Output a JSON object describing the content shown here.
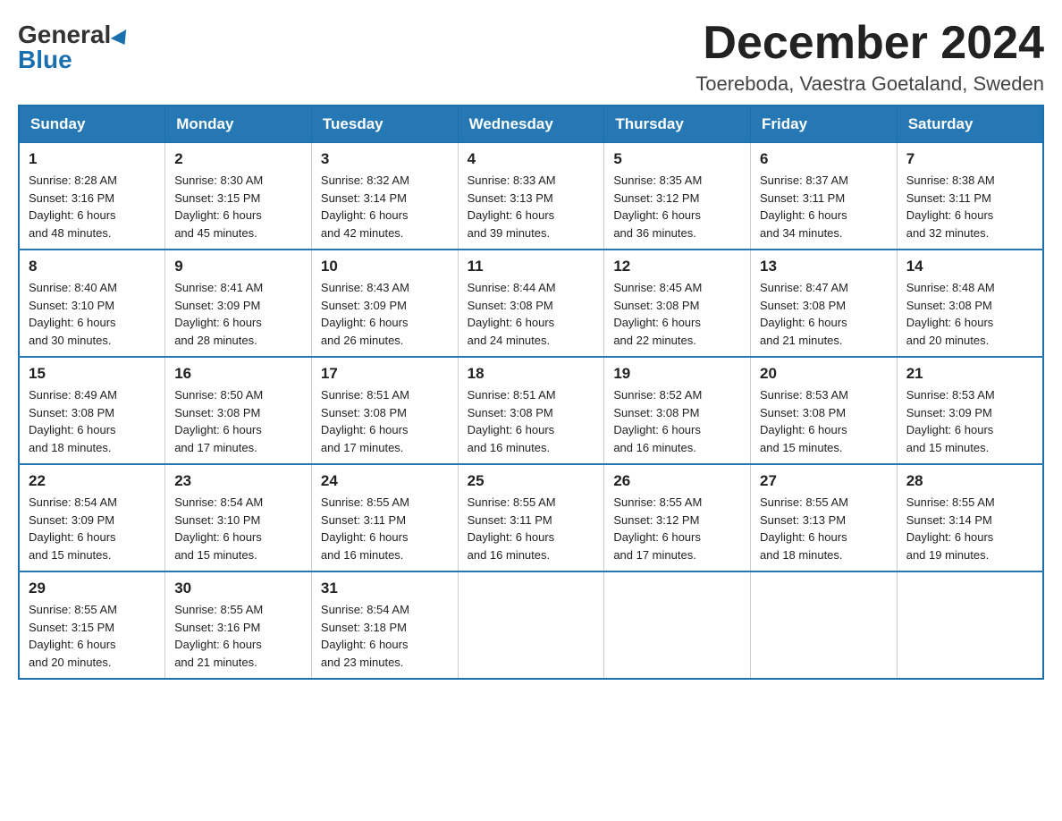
{
  "header": {
    "logo_general": "General",
    "logo_blue": "Blue",
    "month_title": "December 2024",
    "location": "Toereboda, Vaestra Goetaland, Sweden"
  },
  "weekdays": [
    "Sunday",
    "Monday",
    "Tuesday",
    "Wednesday",
    "Thursday",
    "Friday",
    "Saturday"
  ],
  "weeks": [
    [
      {
        "day": "1",
        "sunrise": "8:28 AM",
        "sunset": "3:16 PM",
        "daylight": "6 hours and 48 minutes."
      },
      {
        "day": "2",
        "sunrise": "8:30 AM",
        "sunset": "3:15 PM",
        "daylight": "6 hours and 45 minutes."
      },
      {
        "day": "3",
        "sunrise": "8:32 AM",
        "sunset": "3:14 PM",
        "daylight": "6 hours and 42 minutes."
      },
      {
        "day": "4",
        "sunrise": "8:33 AM",
        "sunset": "3:13 PM",
        "daylight": "6 hours and 39 minutes."
      },
      {
        "day": "5",
        "sunrise": "8:35 AM",
        "sunset": "3:12 PM",
        "daylight": "6 hours and 36 minutes."
      },
      {
        "day": "6",
        "sunrise": "8:37 AM",
        "sunset": "3:11 PM",
        "daylight": "6 hours and 34 minutes."
      },
      {
        "day": "7",
        "sunrise": "8:38 AM",
        "sunset": "3:11 PM",
        "daylight": "6 hours and 32 minutes."
      }
    ],
    [
      {
        "day": "8",
        "sunrise": "8:40 AM",
        "sunset": "3:10 PM",
        "daylight": "6 hours and 30 minutes."
      },
      {
        "day": "9",
        "sunrise": "8:41 AM",
        "sunset": "3:09 PM",
        "daylight": "6 hours and 28 minutes."
      },
      {
        "day": "10",
        "sunrise": "8:43 AM",
        "sunset": "3:09 PM",
        "daylight": "6 hours and 26 minutes."
      },
      {
        "day": "11",
        "sunrise": "8:44 AM",
        "sunset": "3:08 PM",
        "daylight": "6 hours and 24 minutes."
      },
      {
        "day": "12",
        "sunrise": "8:45 AM",
        "sunset": "3:08 PM",
        "daylight": "6 hours and 22 minutes."
      },
      {
        "day": "13",
        "sunrise": "8:47 AM",
        "sunset": "3:08 PM",
        "daylight": "6 hours and 21 minutes."
      },
      {
        "day": "14",
        "sunrise": "8:48 AM",
        "sunset": "3:08 PM",
        "daylight": "6 hours and 20 minutes."
      }
    ],
    [
      {
        "day": "15",
        "sunrise": "8:49 AM",
        "sunset": "3:08 PM",
        "daylight": "6 hours and 18 minutes."
      },
      {
        "day": "16",
        "sunrise": "8:50 AM",
        "sunset": "3:08 PM",
        "daylight": "6 hours and 17 minutes."
      },
      {
        "day": "17",
        "sunrise": "8:51 AM",
        "sunset": "3:08 PM",
        "daylight": "6 hours and 17 minutes."
      },
      {
        "day": "18",
        "sunrise": "8:51 AM",
        "sunset": "3:08 PM",
        "daylight": "6 hours and 16 minutes."
      },
      {
        "day": "19",
        "sunrise": "8:52 AM",
        "sunset": "3:08 PM",
        "daylight": "6 hours and 16 minutes."
      },
      {
        "day": "20",
        "sunrise": "8:53 AM",
        "sunset": "3:08 PM",
        "daylight": "6 hours and 15 minutes."
      },
      {
        "day": "21",
        "sunrise": "8:53 AM",
        "sunset": "3:09 PM",
        "daylight": "6 hours and 15 minutes."
      }
    ],
    [
      {
        "day": "22",
        "sunrise": "8:54 AM",
        "sunset": "3:09 PM",
        "daylight": "6 hours and 15 minutes."
      },
      {
        "day": "23",
        "sunrise": "8:54 AM",
        "sunset": "3:10 PM",
        "daylight": "6 hours and 15 minutes."
      },
      {
        "day": "24",
        "sunrise": "8:55 AM",
        "sunset": "3:11 PM",
        "daylight": "6 hours and 16 minutes."
      },
      {
        "day": "25",
        "sunrise": "8:55 AM",
        "sunset": "3:11 PM",
        "daylight": "6 hours and 16 minutes."
      },
      {
        "day": "26",
        "sunrise": "8:55 AM",
        "sunset": "3:12 PM",
        "daylight": "6 hours and 17 minutes."
      },
      {
        "day": "27",
        "sunrise": "8:55 AM",
        "sunset": "3:13 PM",
        "daylight": "6 hours and 18 minutes."
      },
      {
        "day": "28",
        "sunrise": "8:55 AM",
        "sunset": "3:14 PM",
        "daylight": "6 hours and 19 minutes."
      }
    ],
    [
      {
        "day": "29",
        "sunrise": "8:55 AM",
        "sunset": "3:15 PM",
        "daylight": "6 hours and 20 minutes."
      },
      {
        "day": "30",
        "sunrise": "8:55 AM",
        "sunset": "3:16 PM",
        "daylight": "6 hours and 21 minutes."
      },
      {
        "day": "31",
        "sunrise": "8:54 AM",
        "sunset": "3:18 PM",
        "daylight": "6 hours and 23 minutes."
      },
      null,
      null,
      null,
      null
    ]
  ],
  "labels": {
    "sunrise": "Sunrise:",
    "sunset": "Sunset:",
    "daylight": "Daylight:"
  }
}
